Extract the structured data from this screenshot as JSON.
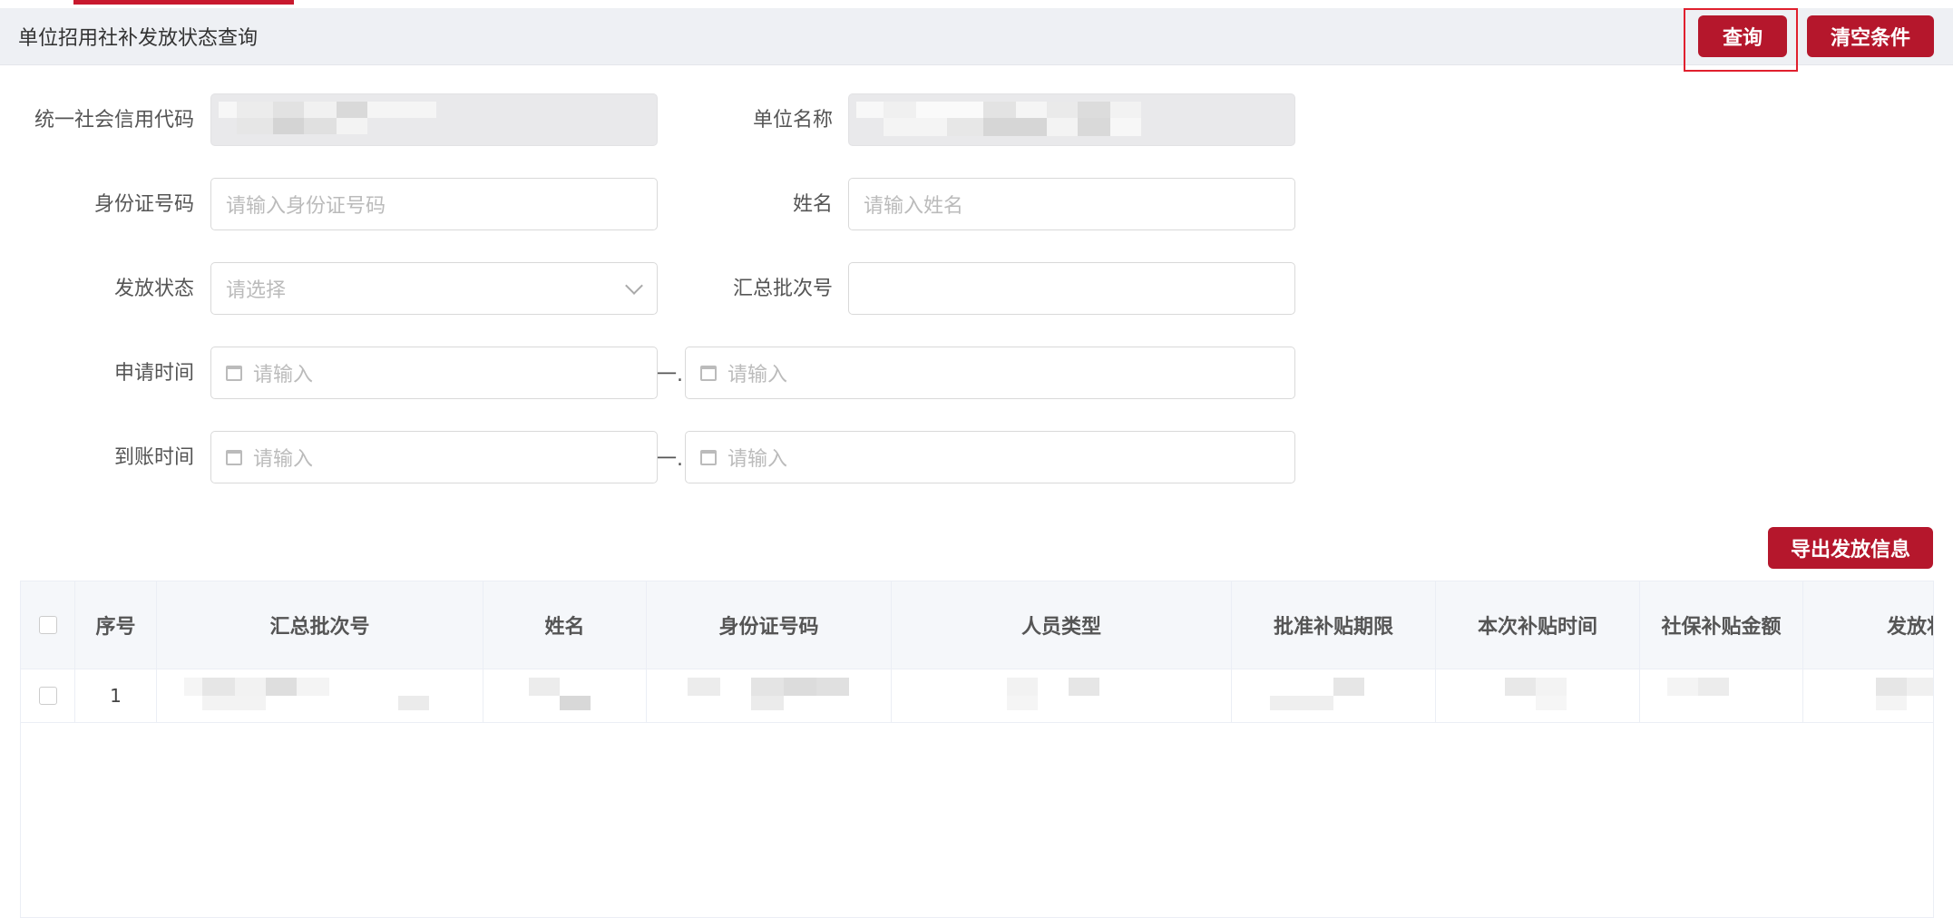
{
  "header": {
    "title": "单位招用社补发放状态查询"
  },
  "actions": {
    "query_label": "查询",
    "clear_label": "清空条件",
    "export_label": "导出发放信息"
  },
  "form": {
    "credit_code_label": "统一社会信用代码",
    "unit_name_label": "单位名称",
    "id_label": "身份证号码",
    "id_placeholder": "请输入身份证号码",
    "name_label": "姓名",
    "name_placeholder": "请输入姓名",
    "status_label": "发放状态",
    "status_placeholder": "请选择",
    "batch_label": "汇总批次号",
    "batch_value": "",
    "apply_time_label": "申请时间",
    "arrive_time_label": "到账时间",
    "date_placeholder": "请输入",
    "range_separator": "一."
  },
  "table": {
    "headers": [
      "序号",
      "汇总批次号",
      "姓名",
      "身份证号码",
      "人员类型",
      "批准补贴期限",
      "本次补贴时间",
      "社保补贴金额",
      "发放状态"
    ],
    "rows": [
      {
        "index": "1"
      }
    ]
  }
}
